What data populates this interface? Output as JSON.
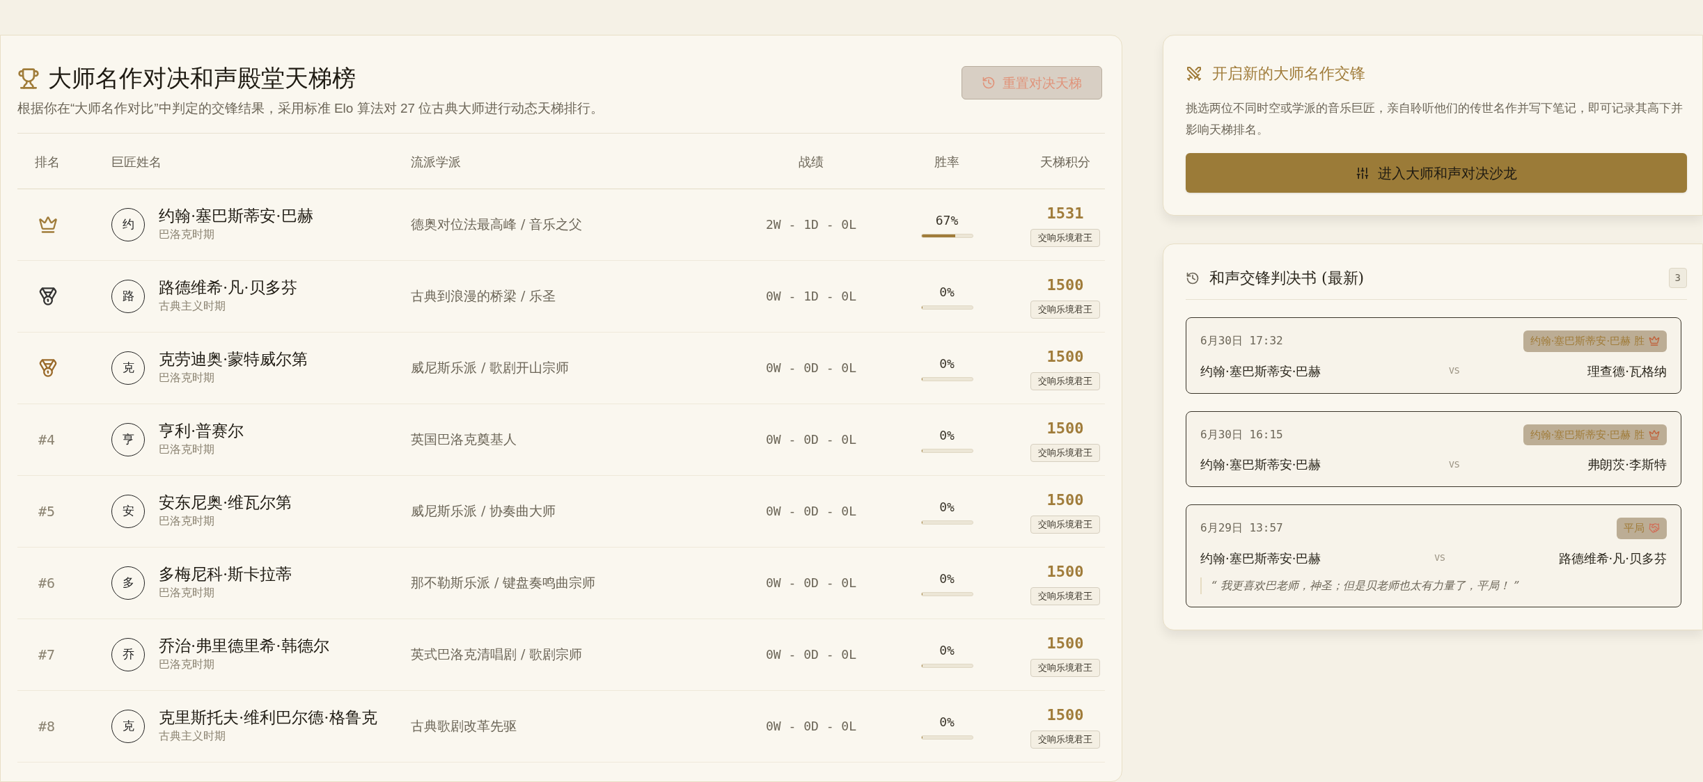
{
  "ladder": {
    "title": "大师名作对决和声殿堂天梯榜",
    "subtitle": "根据你在“大师名作对比”中判定的交锋结果，采用标准 Elo 算法对 27 位古典大师进行动态天梯排行。",
    "reset_button": {
      "label": "重置对决天梯",
      "disabled": true
    },
    "columns": [
      "排名",
      "巨匠姓名",
      "流派学派",
      "战绩",
      "胜率",
      "天梯积分"
    ],
    "rows": [
      {
        "rank": {
          "kind": "crown",
          "color": "#a07c3a"
        },
        "avatar": "约",
        "name": "约翰·塞巴斯蒂安·巴赫",
        "period": "巴洛克时期",
        "school": "德奥对位法最高峰 / 音乐之父",
        "record": "2W - 1D - 0L",
        "win_rate": "67%",
        "level": 0.67,
        "points": "1531",
        "title_badge": "交响乐境君王"
      },
      {
        "rank": {
          "kind": "medal",
          "color": "#333333"
        },
        "avatar": "路",
        "name": "路德维希·凡·贝多芬",
        "period": "古典主义时期",
        "school": "古典到浪漫的桥梁 / 乐圣",
        "record": "0W - 1D - 0L",
        "win_rate": "0%",
        "level": 0,
        "points": "1500",
        "title_badge": "交响乐境君王"
      },
      {
        "rank": {
          "kind": "medal",
          "color": "#9a6a2a"
        },
        "avatar": "克",
        "name": "克劳迪奥·蒙特威尔第",
        "period": "巴洛克时期",
        "school": "威尼斯乐派 / 歌剧开山宗师",
        "record": "0W - 0D - 0L",
        "win_rate": "0%",
        "level": 0,
        "points": "1500",
        "title_badge": "交响乐境君王"
      },
      {
        "rank": {
          "kind": "number",
          "label": "#4"
        },
        "avatar": "亨",
        "name": "亨利·普赛尔",
        "period": "巴洛克时期",
        "school": "英国巴洛克奠基人",
        "record": "0W - 0D - 0L",
        "win_rate": "0%",
        "level": 0,
        "points": "1500",
        "title_badge": "交响乐境君王"
      },
      {
        "rank": {
          "kind": "number",
          "label": "#5"
        },
        "avatar": "安",
        "name": "安东尼奥·维瓦尔第",
        "period": "巴洛克时期",
        "school": "威尼斯乐派 / 协奏曲大师",
        "record": "0W - 0D - 0L",
        "win_rate": "0%",
        "level": 0,
        "points": "1500",
        "title_badge": "交响乐境君王"
      },
      {
        "rank": {
          "kind": "number",
          "label": "#6"
        },
        "avatar": "多",
        "name": "多梅尼科·斯卡拉蒂",
        "period": "巴洛克时期",
        "school": "那不勒斯乐派 / 键盘奏鸣曲宗师",
        "record": "0W - 0D - 0L",
        "win_rate": "0%",
        "level": 0,
        "points": "1500",
        "title_badge": "交响乐境君王"
      },
      {
        "rank": {
          "kind": "number",
          "label": "#7"
        },
        "avatar": "乔",
        "name": "乔治·弗里德里希·韩德尔",
        "period": "巴洛克时期",
        "school": "英式巴洛克清唱剧 / 歌剧宗师",
        "record": "0W - 0D - 0L",
        "win_rate": "0%",
        "level": 0,
        "points": "1500",
        "title_badge": "交响乐境君王"
      },
      {
        "rank": {
          "kind": "number",
          "label": "#8"
        },
        "avatar": "克",
        "name": "克里斯托夫·维利巴尔德·格鲁克",
        "period": "古典主义时期",
        "school": "古典歌剧改革先驱",
        "record": "0W - 0D - 0L",
        "win_rate": "0%",
        "level": 0,
        "points": "1500",
        "title_badge": "交响乐境君王"
      }
    ]
  },
  "new_duel": {
    "title": "开启新的大师名作交锋",
    "description": "挑选两位不同时空或学派的音乐巨匠，亲自聆听他们的传世名作并写下笔记，即可记录其高下并影响天梯排名。",
    "button": "进入大师和声对决沙龙"
  },
  "verdicts": {
    "title": "和声交锋判决书 (最新)",
    "count": "3",
    "items": [
      {
        "time": "6月30日 17:32",
        "result": {
          "kind": "win",
          "label": "约翰·塞巴斯蒂安·巴赫 胜"
        },
        "left": "约翰·塞巴斯蒂安·巴赫",
        "vs": "VS",
        "right": "理查德·瓦格纳"
      },
      {
        "time": "6月30日 16:15",
        "result": {
          "kind": "win",
          "label": "约翰·塞巴斯蒂安·巴赫 胜"
        },
        "left": "约翰·塞巴斯蒂安·巴赫",
        "vs": "VS",
        "right": "弗朗茨·李斯特"
      },
      {
        "time": "6月29日 13:57",
        "result": {
          "kind": "draw",
          "label": "平局"
        },
        "left": "约翰·塞巴斯蒂安·巴赫",
        "vs": "VS",
        "right": "路德维希·凡·贝多芬",
        "note": "“ 我更喜欢巴老师，神圣；但是贝老师也太有力量了，平局！ ”"
      }
    ]
  }
}
